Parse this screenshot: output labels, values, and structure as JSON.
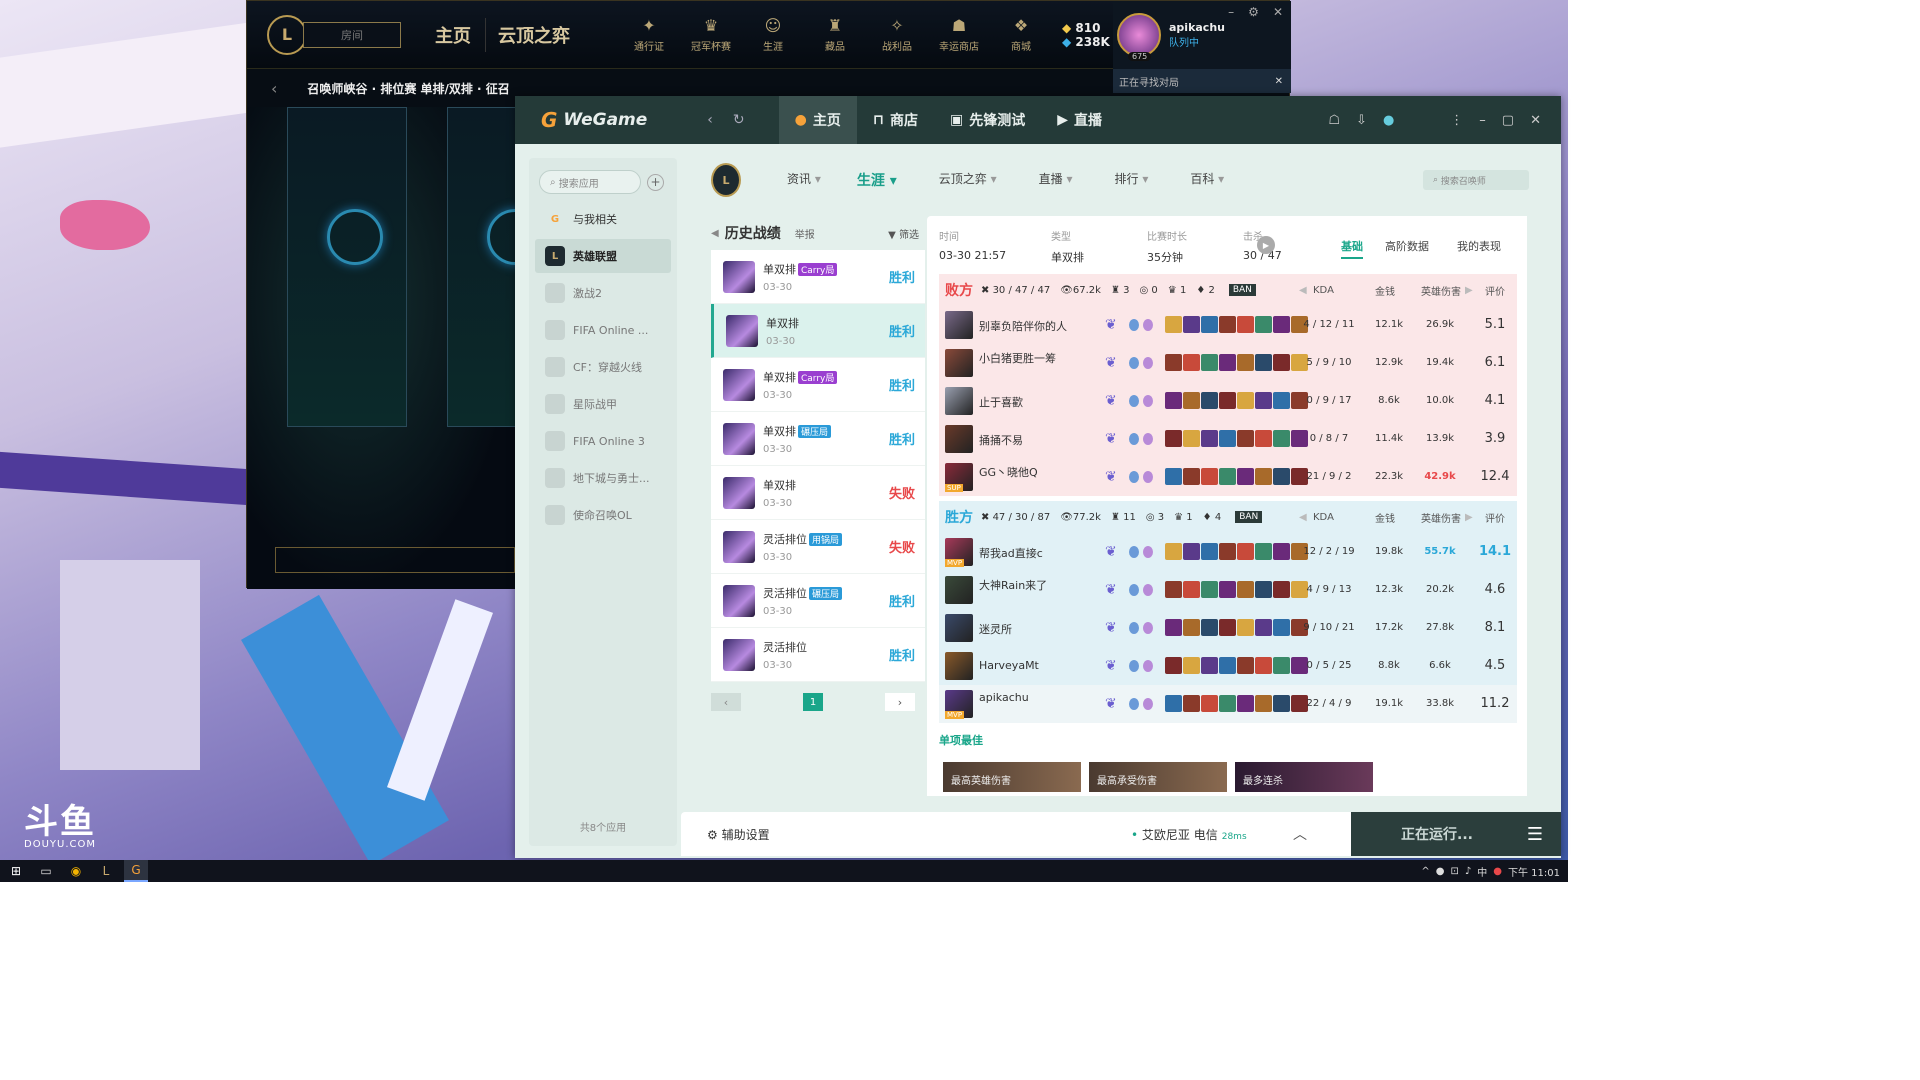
{
  "desktop": {
    "logo_text": "斗鱼",
    "logo_sub": "DOUYU.COM"
  },
  "lol": {
    "room_placeholder": "房间",
    "nav_home": "主页",
    "nav_tft": "云顶之弈",
    "icons": [
      {
        "label": "通行证",
        "icon": "pass-icon"
      },
      {
        "label": "冠军杯赛",
        "icon": "trophy-icon"
      },
      {
        "label": "生涯",
        "icon": "profile-icon"
      },
      {
        "label": "藏品",
        "icon": "collection-icon"
      },
      {
        "label": "战利品",
        "icon": "loot-icon"
      },
      {
        "label": "幸运商店",
        "icon": "lucky-shop-icon"
      },
      {
        "label": "商城",
        "icon": "store-icon"
      }
    ],
    "currency_rp": "810",
    "currency_be": "238K",
    "player_name": "apikachu",
    "player_level": "675",
    "player_status": "队列中",
    "mode_text": "召唤师峡谷 · 排位赛 单排/双排 · 征召",
    "finding_text": "正在寻找对局"
  },
  "wegame": {
    "brand": "WeGame",
    "tabs": [
      {
        "label": "主页",
        "icon": "home-icon",
        "active": true
      },
      {
        "label": "商店",
        "icon": "bag-icon",
        "active": false
      },
      {
        "label": "先锋测试",
        "icon": "gamepad-icon",
        "active": false
      },
      {
        "label": "直播",
        "icon": "tv-icon",
        "active": false
      }
    ]
  },
  "sidebar": {
    "search_placeholder": "搜索应用",
    "items": [
      {
        "label": "与我相关",
        "icon": "related-icon"
      },
      {
        "label": "英雄联盟",
        "icon": "lol-icon"
      },
      {
        "label": "激战2",
        "icon": "gw2-icon"
      },
      {
        "label": "FIFA Online ...",
        "icon": "fifa4-icon"
      },
      {
        "label": "CF：穿越火线",
        "icon": "cf-icon"
      },
      {
        "label": "星际战甲",
        "icon": "warframe-icon"
      },
      {
        "label": "FIFA Online 3",
        "icon": "fifa3-icon"
      },
      {
        "label": "地下城与勇士...",
        "icon": "dnf-icon"
      },
      {
        "label": "使命召唤OL",
        "icon": "cod-icon"
      }
    ],
    "count": "共8个应用"
  },
  "subnav": {
    "items": [
      {
        "label": "资讯"
      },
      {
        "label": "生涯"
      },
      {
        "label": "云顶之弈"
      },
      {
        "label": "直播"
      },
      {
        "label": "排行"
      },
      {
        "label": "百科"
      }
    ],
    "search_placeholder": "搜索召唤师"
  },
  "history": {
    "title": "历史战绩",
    "report": "举报",
    "filter": "筛选",
    "rows": [
      {
        "mode": "单双排",
        "badge": "Carry局",
        "date": "03-30",
        "result": "胜利"
      },
      {
        "mode": "单双排",
        "badge": "",
        "date": "03-30",
        "result": "胜利"
      },
      {
        "mode": "单双排",
        "badge": "Carry局",
        "date": "03-30",
        "result": "胜利"
      },
      {
        "mode": "单双排",
        "badge": "碾压局",
        "date": "03-30",
        "result": "胜利"
      },
      {
        "mode": "单双排",
        "badge": "",
        "date": "03-30",
        "result": "失败"
      },
      {
        "mode": "灵活排位",
        "badge": "用锅局",
        "date": "03-30",
        "result": "失败"
      },
      {
        "mode": "灵活排位",
        "badge": "碾压局",
        "date": "03-30",
        "result": "胜利"
      },
      {
        "mode": "灵活排位",
        "badge": "",
        "date": "03-30",
        "result": "胜利"
      }
    ],
    "page": "1"
  },
  "detail": {
    "meta": [
      {
        "k": "时间",
        "v": "03-30 21:57"
      },
      {
        "k": "类型",
        "v": "单双排"
      },
      {
        "k": "比赛时长",
        "v": "35分钟"
      },
      {
        "k": "击杀",
        "v": "30 / 47"
      }
    ],
    "tabs": [
      {
        "label": "基础"
      },
      {
        "label": "高阶数据"
      },
      {
        "label": "我的表现"
      }
    ],
    "cols": {
      "kda": "KDA",
      "gold": "金钱",
      "dmg": "英雄伤害",
      "rating": "评价"
    },
    "lose_team": {
      "name": "败方",
      "kda": "30 / 47 / 47",
      "gold": "67.2k",
      "towers": "3",
      "dragons": "0",
      "barons": "1",
      "heralds": "2",
      "ban": "BAN",
      "players": [
        {
          "name": "别辜负陪伴你的人",
          "kda": "4 / 12 / 11",
          "gold": "12.1k",
          "dmg": "26.9k",
          "rating": "5.1"
        },
        {
          "name": "小白猪更胜一筹",
          "kda": "5 / 9 / 10",
          "gold": "12.9k",
          "dmg": "19.4k",
          "rating": "6.1"
        },
        {
          "name": "止于喜歡",
          "kda": "0 / 9 / 17",
          "gold": "8.6k",
          "dmg": "10.0k",
          "rating": "4.1"
        },
        {
          "name": "捅捅不易",
          "kda": "0 / 8 / 7",
          "gold": "11.4k",
          "dmg": "13.9k",
          "rating": "3.9"
        },
        {
          "name": "GG丶晓他Q",
          "kda": "21 / 9 / 2",
          "gold": "22.3k",
          "dmg": "42.9k",
          "rating": "12.4"
        }
      ]
    },
    "win_team": {
      "name": "胜方",
      "kda": "47 / 30 / 87",
      "gold": "77.2k",
      "towers": "11",
      "dragons": "3",
      "barons": "1",
      "heralds": "4",
      "ban": "BAN",
      "players": [
        {
          "name": "帮我ad直接c",
          "kda": "12 / 2 / 19",
          "gold": "19.8k",
          "dmg": "55.7k",
          "rating": "14.1"
        },
        {
          "name": "大神Rain来了",
          "kda": "4 / 9 / 13",
          "gold": "12.3k",
          "dmg": "20.2k",
          "rating": "4.6"
        },
        {
          "name": "迷灵所",
          "kda": "9 / 10 / 21",
          "gold": "17.2k",
          "dmg": "27.8k",
          "rating": "8.1"
        },
        {
          "name": "HarveyaMt",
          "kda": "0 / 5 / 25",
          "gold": "8.8k",
          "dmg": "6.6k",
          "rating": "4.5"
        },
        {
          "name": "apikachu",
          "kda": "22 / 4 / 9",
          "gold": "19.1k",
          "dmg": "33.8k",
          "rating": "11.2"
        }
      ]
    },
    "best_title": "单项最佳",
    "best_cards": [
      "最高英雄伤害",
      "最高承受伤害",
      "最多连杀"
    ]
  },
  "bottom": {
    "assist": "辅助设置",
    "server": "艾欧尼亚 电信",
    "ping": "28ms",
    "running": "正在运行..."
  },
  "taskbar": {
    "time": "下午 11:01",
    "ime": "中"
  },
  "colors": {
    "accent": "#1aa68a",
    "win": "#2ba8d8",
    "lose": "#e8484a"
  }
}
